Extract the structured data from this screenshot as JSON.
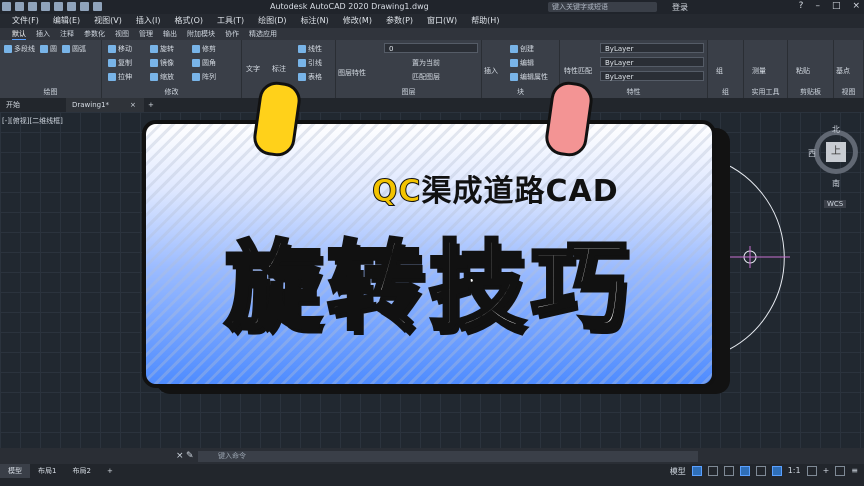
{
  "titlebar": {
    "title": "Autodesk AutoCAD 2020    Drawing1.dwg",
    "search_placeholder": "键入关键字或短语",
    "login": "登录",
    "help": "?"
  },
  "menu": [
    "文件(F)",
    "编辑(E)",
    "视图(V)",
    "插入(I)",
    "格式(O)",
    "工具(T)",
    "绘图(D)",
    "标注(N)",
    "修改(M)",
    "参数(P)",
    "窗口(W)",
    "帮助(H)"
  ],
  "ribbon_tabs": [
    "默认",
    "插入",
    "注释",
    "参数化",
    "视图",
    "管理",
    "输出",
    "附加模块",
    "协作",
    "精选应用"
  ],
  "ribbon": {
    "draw_label": "绘图",
    "modify_label": "修改",
    "layers_label": "图层",
    "block_label": "块",
    "properties_label": "特性",
    "groups_label": "组",
    "utilities_label": "实用工具",
    "clipboard_label": "剪贴板",
    "view_label": "视图",
    "tools": {
      "polyline": "多段线",
      "circle": "圆",
      "arc": "圆弧",
      "move": "移动",
      "rotate": "旋转",
      "trim": "修剪",
      "copy": "复制",
      "mirror": "镜像",
      "fillet": "圆角",
      "stretch": "拉伸",
      "scale": "缩放",
      "array": "阵列",
      "text": "文字",
      "dimension": "标注",
      "linear": "线性",
      "leader": "引线",
      "table": "表格",
      "layer_props": "图层特性",
      "insert": "插入",
      "create": "创建",
      "edit": "编辑",
      "edit_attr": "编辑属性",
      "match": "特性匹配",
      "group": "组",
      "measure": "测量",
      "paste": "粘贴",
      "base": "基点",
      "make_current": "置为当前",
      "match_layer": "匹配图层"
    },
    "layer_value": "0",
    "bylayer_color": "ByLayer",
    "bylayer_linetype": "ByLayer",
    "bylayer_lineweight": "ByLayer"
  },
  "doc_tabs": [
    "开始",
    "Drawing1*"
  ],
  "view_label": "[-][俯视][二维线框]",
  "viewcube": {
    "north": "北",
    "south": "南",
    "west": "西",
    "face": "上",
    "wcs": "WCS"
  },
  "card": {
    "brand": "QC",
    "subtitle": "渠成道路CAD",
    "title": "旋转技巧"
  },
  "command_placeholder": "键入命令",
  "layout_tabs": [
    "模型",
    "布局1",
    "布局2"
  ],
  "status": {
    "model": "模型",
    "scale": "1:1"
  }
}
